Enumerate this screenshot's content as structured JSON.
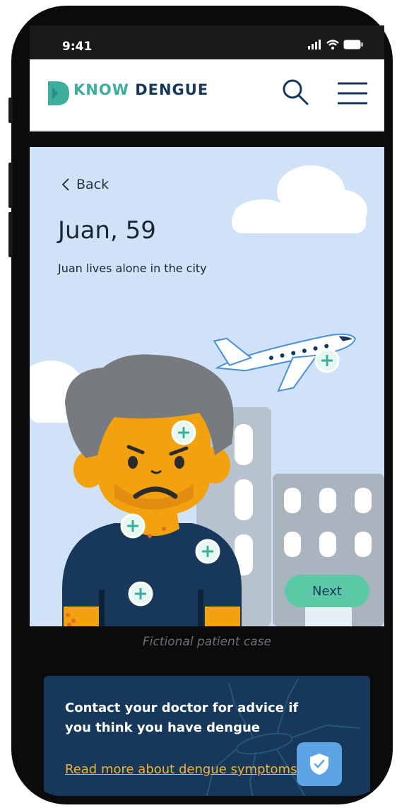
{
  "status_bar": {
    "time": "9:41",
    "icons": [
      "signal-icon",
      "wifi-icon",
      "battery-icon"
    ]
  },
  "header": {
    "logo": {
      "word1": "KNOW",
      "word2": "DENGUE"
    },
    "icons": [
      "search-icon",
      "hamburger-menu-icon"
    ]
  },
  "hero": {
    "back_label": "Back",
    "title": "Juan, 59",
    "subtitle": "Juan lives alone in the city",
    "next_label": "Next",
    "hotspot_icon": "plus-icon"
  },
  "caption": "Fictional patient case",
  "cta": {
    "text": "Contact your doctor for advice if you think you have dengue",
    "link": "Read more about dengue symptoms"
  },
  "floating_icon": "shield-check-icon",
  "colors": {
    "brand_teal": "#3dae9d",
    "brand_navy": "#16375a",
    "sky": "#cfe2f7",
    "next_green": "#5bc9a6",
    "link_orange": "#f2b13c",
    "shield_blue": "#5ca4e4"
  }
}
